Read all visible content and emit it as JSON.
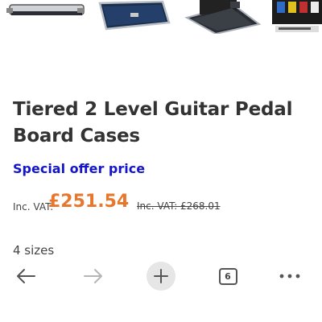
{
  "gallery": {
    "images": [
      {
        "name": "pedal-board-case-closed-image"
      },
      {
        "name": "pedal-board-case-angle-image"
      },
      {
        "name": "pedal-board-case-open-image"
      },
      {
        "name": "pedal-board-case-with-pedals-image"
      }
    ]
  },
  "product": {
    "title": "Tiered 2 Level Guitar Pedal Board Cases",
    "offer_label": "Special offer price",
    "vat_label": "Inc. VAT:",
    "price": "£251.54",
    "old_price": "Inc. VAT: £268.01",
    "sizes": "4 sizes"
  },
  "toolbar": {
    "back_icon": "arrow-left-icon",
    "forward_icon": "arrow-right-icon",
    "new_tab_icon": "plus-icon",
    "tab_count": "6",
    "menu_icon": "more-dots-icon"
  },
  "colors": {
    "offer": "#1414c8",
    "price": "#e8772e",
    "text": "#333333"
  }
}
